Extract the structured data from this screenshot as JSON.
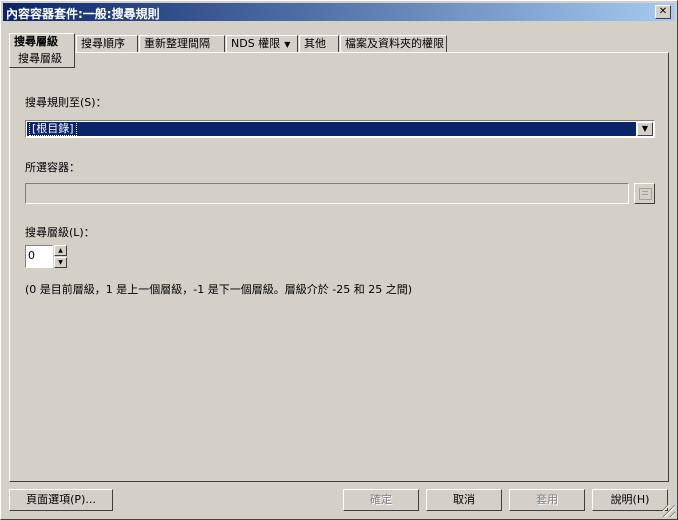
{
  "window": {
    "title": "內容容器套件:一般:搜尋規則",
    "close_label": "✕"
  },
  "tabs": [
    {
      "label": "搜尋層級",
      "active": true
    },
    {
      "label": "搜尋順序"
    },
    {
      "label": "重新整理間隔"
    },
    {
      "label": "NDS 權限",
      "dropdown": "▼"
    },
    {
      "label": "其他"
    },
    {
      "label": "檔案及資料夾的權限"
    }
  ],
  "subtab": {
    "label": "搜尋層級"
  },
  "form": {
    "search_rule_label": "搜尋規則至(S)：",
    "search_rule_value": "[根目錄]",
    "selected_container_label": "所選容器：",
    "selected_container_value": "",
    "search_level_label": "搜尋層級(L)：",
    "search_level_value": "0",
    "help_text": "(0 是目前層級，1 是上一個層級，-1 是下一個層級。層級介於 -25 和 25 之間)"
  },
  "buttons": {
    "page_options": "頁面選項(P)...",
    "ok": "確定",
    "cancel": "取消",
    "apply": "套用",
    "help": "說明(H)"
  },
  "icons": {
    "combo_arrow": "▼",
    "spin_up": "▲",
    "spin_down": "▼"
  }
}
